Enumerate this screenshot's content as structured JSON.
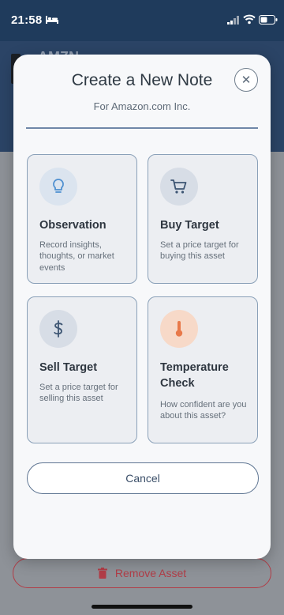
{
  "status_bar": {
    "time": "21:58"
  },
  "background": {
    "ticker": "AMZN",
    "remove_button_label": "Remove Asset"
  },
  "modal": {
    "title": "Create a New Note",
    "subtitle": "For Amazon.com Inc.",
    "close_glyph": "✕",
    "cancel_label": "Cancel",
    "options": [
      {
        "title": "Observation",
        "description": "Record insights, thoughts, or market events",
        "icon": "lightbulb-icon"
      },
      {
        "title": "Buy Target",
        "description": "Set a price target for buying this asset",
        "icon": "cart-icon"
      },
      {
        "title": "Sell Target",
        "description": "Set a price target for selling this asset",
        "icon": "dollar-icon"
      },
      {
        "title": "Temperature Check",
        "description": "How confident are you about this asset?",
        "icon": "thermometer-icon"
      }
    ]
  },
  "colors": {
    "accent": "#5e7592",
    "danger": "#b13d47",
    "temperature": "#e8794a"
  }
}
